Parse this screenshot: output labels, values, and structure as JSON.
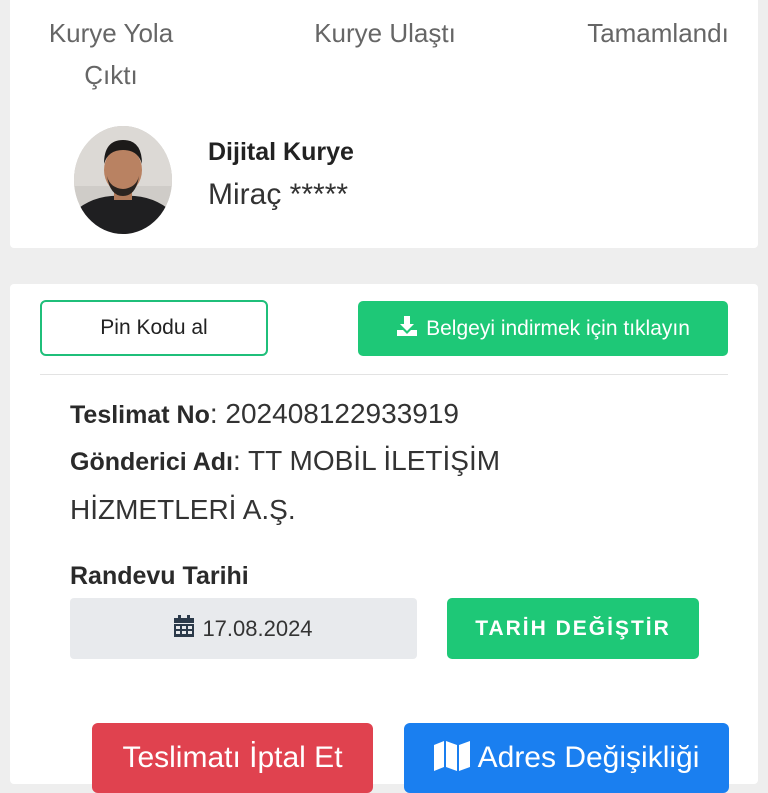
{
  "steps": {
    "on_the_way": "Kurye Yola Çıktı",
    "arrived": "Kurye Ulaştı",
    "completed": "Tamamlandı"
  },
  "courier": {
    "title": "Dijital Kurye",
    "name": "Miraç *****"
  },
  "actions": {
    "pin_label": "Pin Kodu al",
    "download_label": "Belgeyi indirmek için tıklayın",
    "download_icon": "download-icon"
  },
  "delivery": {
    "no_label": "Teslimat No",
    "no_value": "202408122933919",
    "sender_label": "Gönderici Adı",
    "sender_value": "TT MOBİL İLETİŞİM HİZMETLERİ A.Ş."
  },
  "appointment": {
    "label": "Randevu Tarihi",
    "date": "17.08.2024",
    "calendar_icon": "calendar-icon",
    "change_label": "TARİH DEĞİŞTİR"
  },
  "bottom_actions": {
    "cancel_label": "Teslimatı İptal Et",
    "address_label": "Adres Değişikliği",
    "address_icon": "map-icon"
  },
  "colors": {
    "green": "#1ec877",
    "red": "#e0424f",
    "blue": "#1a7ff0",
    "date_box": "#e8eaed"
  }
}
